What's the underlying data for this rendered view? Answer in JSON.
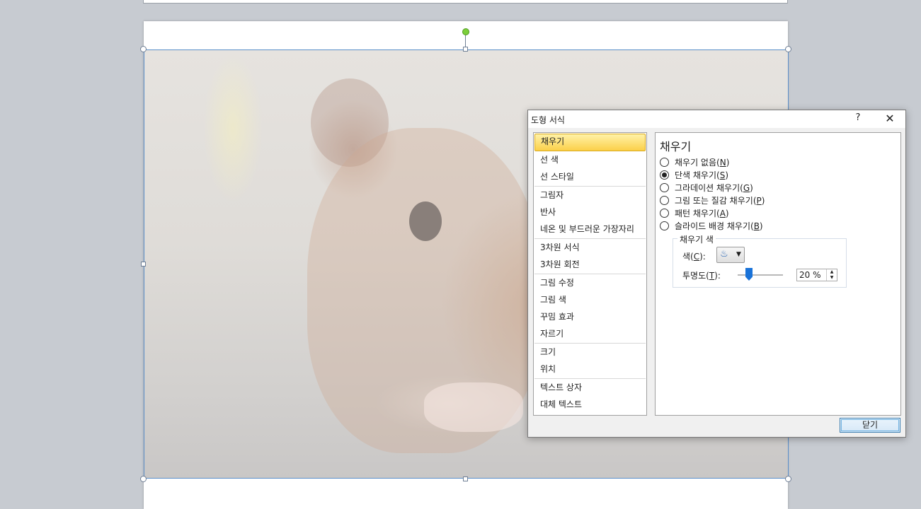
{
  "dialog": {
    "title": "도형 서식",
    "help": "?",
    "close_glyph": "✕",
    "nav": [
      {
        "label": "채우기",
        "selected": true
      },
      {
        "label": "선 색"
      },
      {
        "label": "선 스타일"
      },
      {
        "label": "그림자"
      },
      {
        "label": "반사"
      },
      {
        "label": "네온 및 부드러운 가장자리"
      },
      {
        "label": "3차원 서식"
      },
      {
        "label": "3차원 회전"
      },
      {
        "label": "그림 수정"
      },
      {
        "label": "그림 색"
      },
      {
        "label": "꾸밈 효과"
      },
      {
        "label": "자르기"
      },
      {
        "label": "크기"
      },
      {
        "label": "위치"
      },
      {
        "label": "텍스트 상자"
      },
      {
        "label": "대체 텍스트"
      }
    ],
    "panel": {
      "heading": "채우기",
      "options": [
        {
          "label": "채우기 없음",
          "key": "N",
          "checked": false
        },
        {
          "label": "단색 채우기",
          "key": "S",
          "checked": true
        },
        {
          "label": "그라데이션 채우기",
          "key": "G",
          "checked": false
        },
        {
          "label": "그림 또는 질감 채우기",
          "key": "P",
          "checked": false
        },
        {
          "label": "패턴 채우기",
          "key": "A",
          "checked": false
        },
        {
          "label": "슬라이드 배경 채우기",
          "key": "B",
          "checked": false
        }
      ],
      "fill_color_group": {
        "legend": "채우기 색",
        "color_label": "색",
        "color_key": "C",
        "transparency_label": "투명도",
        "transparency_key": "T",
        "transparency_value": "20 %",
        "transparency_percent": 20,
        "color_icon": "paint-bucket-icon"
      }
    },
    "close_button": "닫기"
  }
}
